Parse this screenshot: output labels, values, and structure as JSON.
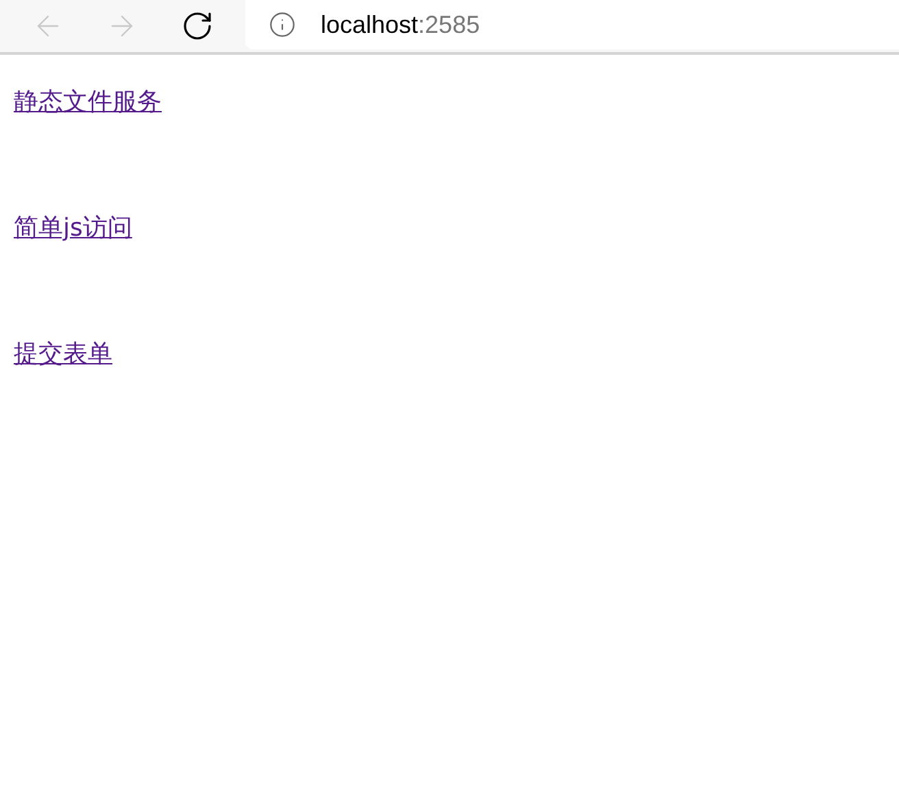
{
  "toolbar": {
    "back": {
      "disabled": true
    },
    "forward": {
      "disabled": true
    }
  },
  "address_bar": {
    "host": "localhost",
    "port": ":2585"
  },
  "links": [
    {
      "label": "静态文件服务"
    },
    {
      "label": "简单js访问"
    },
    {
      "label": "提交表单"
    }
  ]
}
